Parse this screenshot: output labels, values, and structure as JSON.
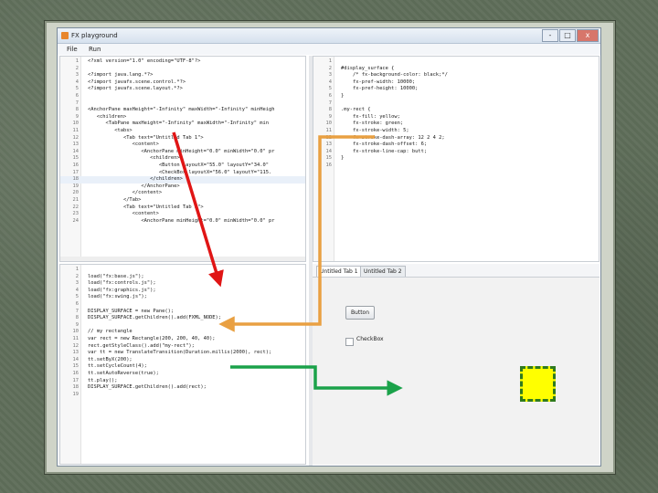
{
  "window": {
    "title": "FX playground",
    "menu": [
      "File",
      "Run"
    ],
    "controls": [
      "-",
      "□",
      "x"
    ]
  },
  "top_left_editor": {
    "lines": [
      {
        "n": "1",
        "code": "<?xml version=\"1.0\" encoding=\"UTF-8\"?>"
      },
      {
        "n": "2",
        "code": ""
      },
      {
        "n": "3",
        "code": "<?import java.lang.*?>"
      },
      {
        "n": "4",
        "code": "<?import javafx.scene.control.*?>"
      },
      {
        "n": "5",
        "code": "<?import javafx.scene.layout.*?>"
      },
      {
        "n": "6",
        "code": ""
      },
      {
        "n": "7",
        "code": ""
      },
      {
        "n": "8",
        "code": "<AnchorPane maxHeight=\"-Infinity\" maxWidth=\"-Infinity\" minHeigh"
      },
      {
        "n": "9",
        "code": "   <children>"
      },
      {
        "n": "10",
        "code": "      <TabPane maxHeight=\"-Infinity\" maxWidth=\"-Infinity\" min"
      },
      {
        "n": "11",
        "code": "         <tabs>"
      },
      {
        "n": "12",
        "code": "            <Tab text=\"Untitled Tab 1\">"
      },
      {
        "n": "13",
        "code": "               <content>"
      },
      {
        "n": "14",
        "code": "                  <AnchorPane minHeight=\"0.0\" minWidth=\"0.0\" pr"
      },
      {
        "n": "15",
        "code": "                     <children>"
      },
      {
        "n": "16",
        "code": "                        <Button layoutX=\"55.0\" layoutY=\"34.0\""
      },
      {
        "n": "17",
        "code": "                        <CheckBox layoutX=\"56.0\" layoutY=\"115."
      },
      {
        "n": "18",
        "code": "                     </children>"
      },
      {
        "n": "19",
        "code": "                  </AnchorPane>"
      },
      {
        "n": "20",
        "code": "               </content>"
      },
      {
        "n": "21",
        "code": "            </Tab>"
      },
      {
        "n": "22",
        "code": "            <Tab text=\"Untitled Tab 2\">"
      },
      {
        "n": "23",
        "code": "               <content>"
      },
      {
        "n": "24",
        "code": "                  <AnchorPane minHeight=\"0.0\" minWidth=\"0.0\" pr"
      }
    ]
  },
  "top_right_editor": {
    "lines": [
      {
        "n": "1",
        "code": ""
      },
      {
        "n": "2",
        "code": "#display_surface {"
      },
      {
        "n": "3",
        "code": "    /* fx-background-color: black;*/"
      },
      {
        "n": "4",
        "code": "    fx-pref-width: 10000;"
      },
      {
        "n": "5",
        "code": "    fx-pref-height: 10000;"
      },
      {
        "n": "6",
        "code": "}"
      },
      {
        "n": "7",
        "code": ""
      },
      {
        "n": "8",
        "code": ".my-rect {"
      },
      {
        "n": "9",
        "code": "    fx-fill: yellow;"
      },
      {
        "n": "10",
        "code": "    fx-stroke: green;"
      },
      {
        "n": "11",
        "code": "    fx-stroke-width: 5;"
      },
      {
        "n": "12",
        "code": "    fx-stroke-dash-array: 12 2 4 2;"
      },
      {
        "n": "13",
        "code": "    fx-stroke-dash-offset: 6;"
      },
      {
        "n": "14",
        "code": "    fx-stroke-line-cap: butt;"
      },
      {
        "n": "15",
        "code": "}"
      },
      {
        "n": "16",
        "code": ""
      }
    ]
  },
  "bottom_left_editor": {
    "lines": [
      {
        "n": "1",
        "code": ""
      },
      {
        "n": "2",
        "code": "load(\"fx:base.js\");"
      },
      {
        "n": "3",
        "code": "load(\"fx:controls.js\");"
      },
      {
        "n": "4",
        "code": "load(\"fx:graphics.js\");"
      },
      {
        "n": "5",
        "code": "load(\"fx:swing.js\");"
      },
      {
        "n": "6",
        "code": ""
      },
      {
        "n": "7",
        "code": "DISPLAY_SURFACE = new Pane();"
      },
      {
        "n": "8",
        "code": "DISPLAY_SURFACE.getChildren().add(FXML_NODE);"
      },
      {
        "n": "9",
        "code": ""
      },
      {
        "n": "10",
        "code": "// my rectangle"
      },
      {
        "n": "11",
        "code": "var rect = new Rectangle(200, 200, 40, 40);"
      },
      {
        "n": "12",
        "code": "rect.getStyleClass().add(\"my-rect\");"
      },
      {
        "n": "13",
        "code": "var tt = new TranslateTransition(Duration.millis(2000), rect);"
      },
      {
        "n": "14",
        "code": "tt.setByX(200);"
      },
      {
        "n": "15",
        "code": "tt.setCycleCount(4);"
      },
      {
        "n": "16",
        "code": "tt.setAutoReverse(true);"
      },
      {
        "n": "17",
        "code": "tt.play();"
      },
      {
        "n": "18",
        "code": "DISPLAY_SURFACE.getChildren().add(rect);"
      },
      {
        "n": "19",
        "code": ""
      }
    ]
  },
  "preview": {
    "tabs": [
      "Untitled Tab 1",
      "Untitled Tab 2"
    ],
    "button_label": "Button",
    "checkbox_label": "CheckBox"
  },
  "colors": {
    "red_arrow": "#e01515",
    "orange_arrow": "#e9a042",
    "green_arrow": "#1ba24a",
    "rect_fill": "#ffff00",
    "rect_stroke": "#2f7a1f"
  }
}
